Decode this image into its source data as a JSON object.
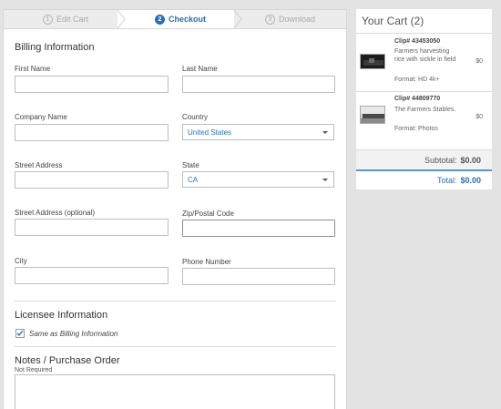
{
  "steps": [
    {
      "number": "1",
      "label": "Edit Cart"
    },
    {
      "number": "2",
      "label": "Checkout"
    },
    {
      "number": "3",
      "label": "Download"
    }
  ],
  "billing": {
    "title": "Billing Information",
    "first_name_label": "First Name",
    "last_name_label": "Last Name",
    "company_label": "Company Name",
    "country_label": "Country",
    "country_value": "United States",
    "street_label": "Street Address",
    "state_label": "State",
    "state_value": "CA",
    "street2_label": "Street Address (optional)",
    "zip_label": "Zip/Postal Code",
    "city_label": "City",
    "phone_label": "Phone Number"
  },
  "licensee": {
    "title": "Licensee Information",
    "same_as_label": "Same as Billing Information",
    "same_as_checked": true
  },
  "notes": {
    "title": "Notes / Purchase Order",
    "subtitle": "Not Required"
  },
  "cart": {
    "title": "Your Cart (2)",
    "items": [
      {
        "clip": "Clip# 43453050",
        "description": "Farmers harvesting rice with sickle in field",
        "format": "Format: HD 4k+",
        "price": "$0"
      },
      {
        "clip": "Clip# 44809770",
        "description": "The Farmers Stables.",
        "format": "Format: Photos",
        "price": "$0"
      }
    ],
    "subtotal_label": "Subtotal:",
    "subtotal_value": "$0.00",
    "total_label": "Total:",
    "total_value": "$0.00"
  },
  "colors": {
    "accent": "#2c6fb2",
    "background": "#e3e3e3"
  }
}
